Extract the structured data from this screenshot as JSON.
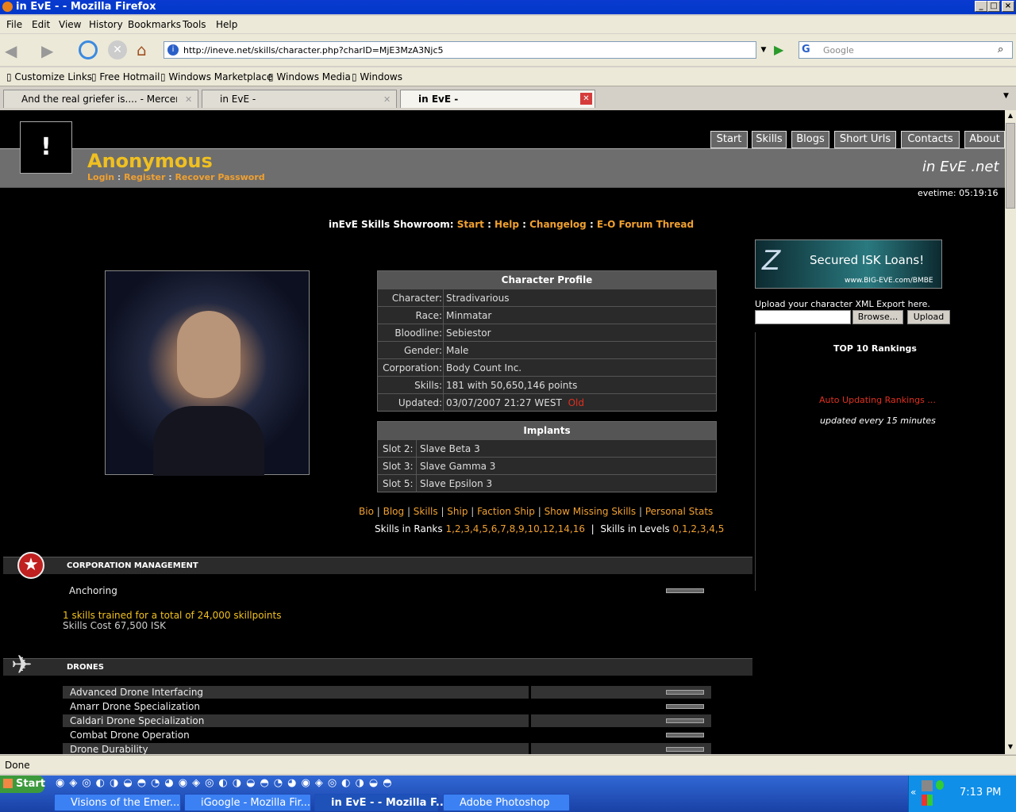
{
  "window": {
    "title": "in EvE - - Mozilla Firefox"
  },
  "menu": [
    "File",
    "Edit",
    "View",
    "History",
    "Bookmarks",
    "Tools",
    "Help"
  ],
  "url": "http://ineve.net/skills/character.php?charID=MjE3MzA3Njc5",
  "search_placeholder": "Google",
  "bookmarks": [
    "Customize Links",
    "Free Hotmail",
    "Windows Marketplace",
    "Windows Media",
    "Windows"
  ],
  "tabs": [
    {
      "label": "And the real griefer is.... - Mercenary Co..."
    },
    {
      "label": "in EvE -"
    },
    {
      "label": "in EvE -"
    }
  ],
  "site": {
    "user": "Anonymous",
    "links": [
      "Login",
      "Register",
      "Recover Password"
    ],
    "nav": [
      "Start",
      "Skills",
      "Blogs",
      "Short Urls",
      "Contacts",
      "About"
    ],
    "brand": "in EvE .net",
    "evetime": "evetime: 05:19:16",
    "showroom_label": "inEvE Skills Showroom:",
    "showroom_links": [
      "Start",
      "Help",
      "Changelog",
      "E-O Forum Thread"
    ]
  },
  "profile": {
    "title": "Character Profile",
    "rows": [
      {
        "label": "Character:",
        "value": "Stradivarious"
      },
      {
        "label": "Race:",
        "value": "Minmatar"
      },
      {
        "label": "Bloodline:",
        "value": "Sebiestor"
      },
      {
        "label": "Gender:",
        "value": "Male"
      },
      {
        "label": "Corporation:",
        "value": "Body Count Inc."
      },
      {
        "label": "Skills:",
        "value": "181 with 50,650,146 points"
      },
      {
        "label": "Updated:",
        "value": "03/07/2007 21:27 WEST"
      }
    ],
    "updated_flag": "Old"
  },
  "implants": {
    "title": "Implants",
    "rows": [
      {
        "label": "Slot 2:",
        "value": "Slave Beta 3"
      },
      {
        "label": "Slot 3:",
        "value": "Slave Gamma 3"
      },
      {
        "label": "Slot 5:",
        "value": "Slave Epsilon 3"
      }
    ]
  },
  "profile_links": [
    "Bio",
    "Blog",
    "Skills",
    "Ship",
    "Faction Ship",
    "Show Missing Skills",
    "Personal Stats"
  ],
  "ranks_label": "Skills in Ranks",
  "ranks": "1,2,3,4,5,6,7,8,9,10,12,14,16",
  "levels_label": "Skills in Levels",
  "levels": "0,1,2,3,4,5",
  "ad": {
    "line1": "Secured ISK Loans!",
    "line2": "www.BIG-EVE.com/BMBE"
  },
  "upload": {
    "text": "Upload your character XML Export here.",
    "browse": "Browse...",
    "upload": "Upload"
  },
  "rankings": {
    "title": "TOP 10 Rankings",
    "auto": "Auto Updating Rankings ...",
    "every": "updated every 15 minutes"
  },
  "corp": {
    "title": "CORPORATION MANAGEMENT",
    "skill": "Anchoring",
    "summary": "1 skills trained for a total of 24,000 skillpoints",
    "cost": "Skills Cost 67,500 ISK"
  },
  "drones": {
    "title": "DRONES",
    "skills": [
      "Advanced Drone Interfacing",
      "Amarr Drone Specialization",
      "Caldari Drone Specialization",
      "Combat Drone Operation",
      "Drone Durability"
    ]
  },
  "status": "Done",
  "taskbar": {
    "start": "Start",
    "items": [
      "Visions of the Emer...",
      "iGoogle - Mozilla Fir...",
      "in EvE - - Mozilla F...",
      "Adobe Photoshop"
    ],
    "clock": "7:13 PM"
  }
}
